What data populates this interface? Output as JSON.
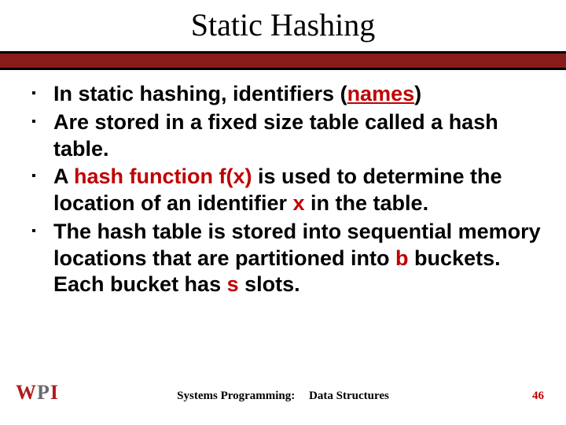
{
  "slide": {
    "title": "Static Hashing",
    "bullets": {
      "b1_a": "In static hashing, identifiers (",
      "b1_b": "names",
      "b1_c": ")",
      "b2": "Are stored in a fixed size table called a hash table.",
      "b3_a": "A ",
      "b3_b": "hash function f(x)",
      "b3_c": " is used to determine the location of an identifier ",
      "b3_d": "x",
      "b3_e": " in the table.",
      "b4_a": "The hash table is stored into sequential memory locations that are partitioned into ",
      "b4_b": "b",
      "b4_c": " buckets. Each bucket has ",
      "b4_d": "s",
      "b4_e": " slots."
    }
  },
  "footer": {
    "logo_w": "W",
    "logo_p": "P",
    "logo_i": "I",
    "center_left": "Systems Programming:",
    "center_right": "Data Structures",
    "page": "46"
  }
}
